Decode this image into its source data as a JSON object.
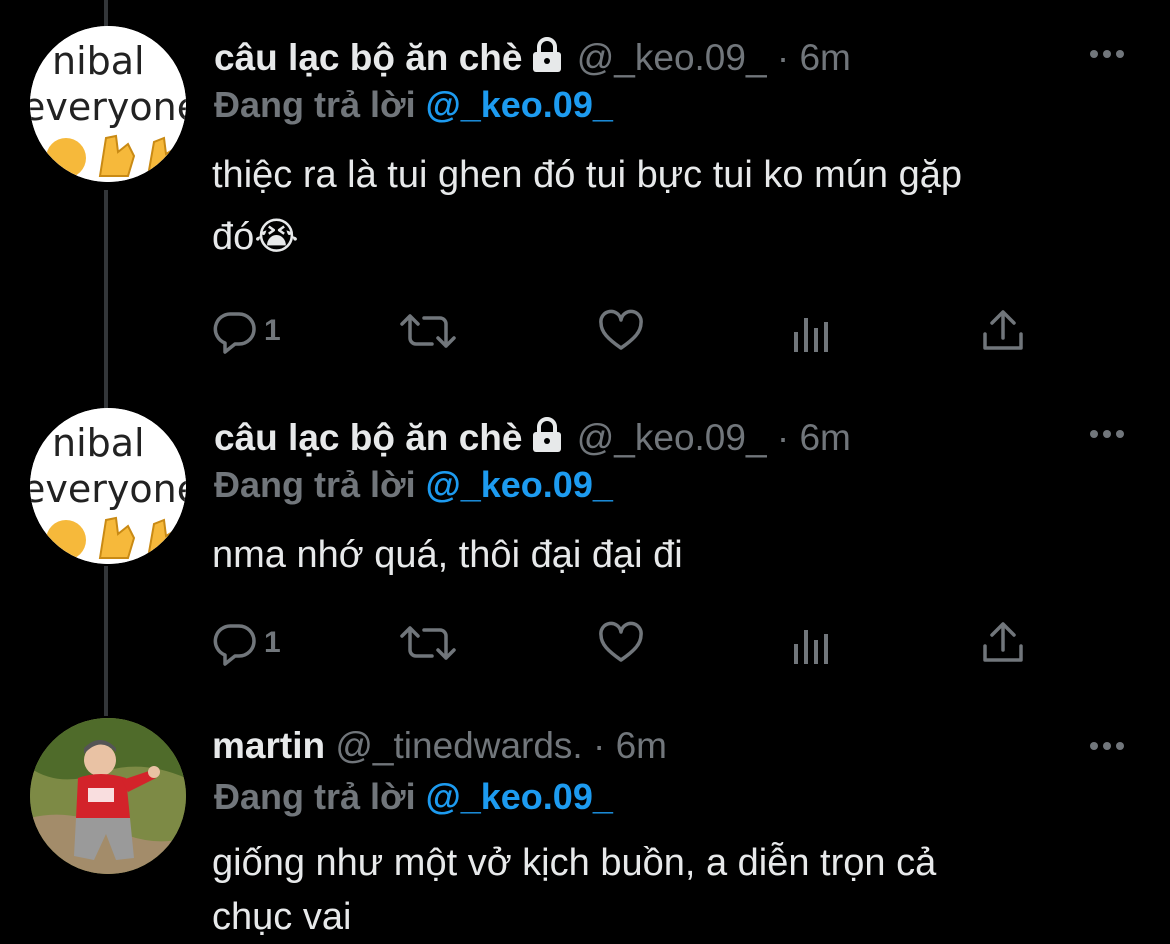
{
  "colors": {
    "background": "#000000",
    "text": "#e7e9ea",
    "secondary": "#71767b",
    "mention": "#1d9bf0",
    "thread_line": "#333639"
  },
  "tweets": [
    {
      "name": "câu lạc bộ ăn chè",
      "protected_icon": "lock-icon",
      "handle": "@_keo.09_",
      "dot": "·",
      "time": "6m",
      "replying_prefix": "Đang trả lời",
      "replying_to": "@_keo.09_",
      "text_line1": "thiệc ra là tui ghen đó tui bực tui ko mún gặp",
      "text_line2": "đó😭",
      "reply_count": "1",
      "avatar_text1": "nibal",
      "avatar_text2": "everyone",
      "avatar_emoji": "🤞🤞"
    },
    {
      "name": "câu lạc bộ ăn chè",
      "protected_icon": "lock-icon",
      "handle": "@_keo.09_",
      "dot": "·",
      "time": "6m",
      "replying_prefix": "Đang trả lời",
      "replying_to": "@_keo.09_",
      "text_line1": "nma nhớ quá, thôi đại đại đi",
      "reply_count": "1",
      "avatar_text1": "nibal",
      "avatar_text2": "everyone",
      "avatar_emoji": "🤞🤞"
    },
    {
      "name": "martin",
      "handle": "@_tinedwards.",
      "dot": "·",
      "time": "6m",
      "replying_prefix": "Đang trả lời",
      "replying_to": "@_keo.09_",
      "text_line1": "giống như một vở kịch buồn, a diễn trọn cả",
      "text_line2": "chục vai"
    }
  ],
  "action_icons": [
    "reply-icon",
    "retweet-icon",
    "like-icon",
    "analytics-icon",
    "share-icon"
  ]
}
